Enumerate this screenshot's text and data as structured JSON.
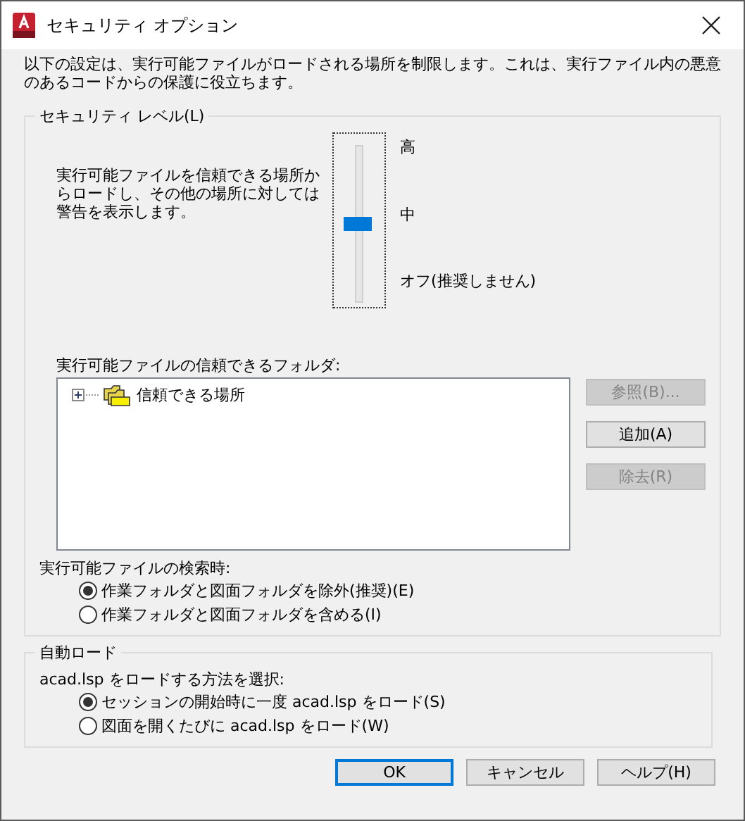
{
  "window": {
    "title": "セキュリティ オプション"
  },
  "description": "以下の設定は、実行可能ファイルがロードされる場所を制限します。これは、実行ファイル内の悪意のあるコードからの保護に役立ちます。",
  "security_level": {
    "title": "セキュリティ レベル(L)",
    "description": "実行可能ファイルを信頼できる場所からロードし、その他の場所に対しては警告を表示します。",
    "slider": {
      "level": 0.5,
      "labels": [
        "高",
        "中",
        "オフ(推奨しません)"
      ]
    },
    "trusted_folders": {
      "label": "実行可能ファイルの信頼できるフォルダ:",
      "tree": [
        {
          "label": "信頼できる場所",
          "expanded": false
        }
      ],
      "buttons": [
        {
          "label": "参照(B)...",
          "disabled": true
        },
        {
          "label": "追加(A)",
          "disabled": false
        },
        {
          "label": "除去(R)",
          "disabled": true
        }
      ]
    },
    "search": {
      "label": "実行可能ファイルの検索時:",
      "options": [
        {
          "label": "作業フォルダと図面フォルダを除外(推奨)(E)",
          "selected": true
        },
        {
          "label": "作業フォルダと図面フォルダを含める(I)",
          "selected": false
        }
      ]
    }
  },
  "autoload": {
    "title": "自動ロード",
    "label": "acad.lsp をロードする方法を選択:",
    "options": [
      {
        "label": "セッションの開始時に一度 acad.lsp をロード(S)",
        "selected": true
      },
      {
        "label": "図面を開くたびに acad.lsp をロード(W)",
        "selected": false
      }
    ]
  },
  "buttons": [
    {
      "label": "OK",
      "default": true
    },
    {
      "label": "キャンセル",
      "default": false
    },
    {
      "label": "ヘルプ(H)",
      "default": false
    }
  ]
}
